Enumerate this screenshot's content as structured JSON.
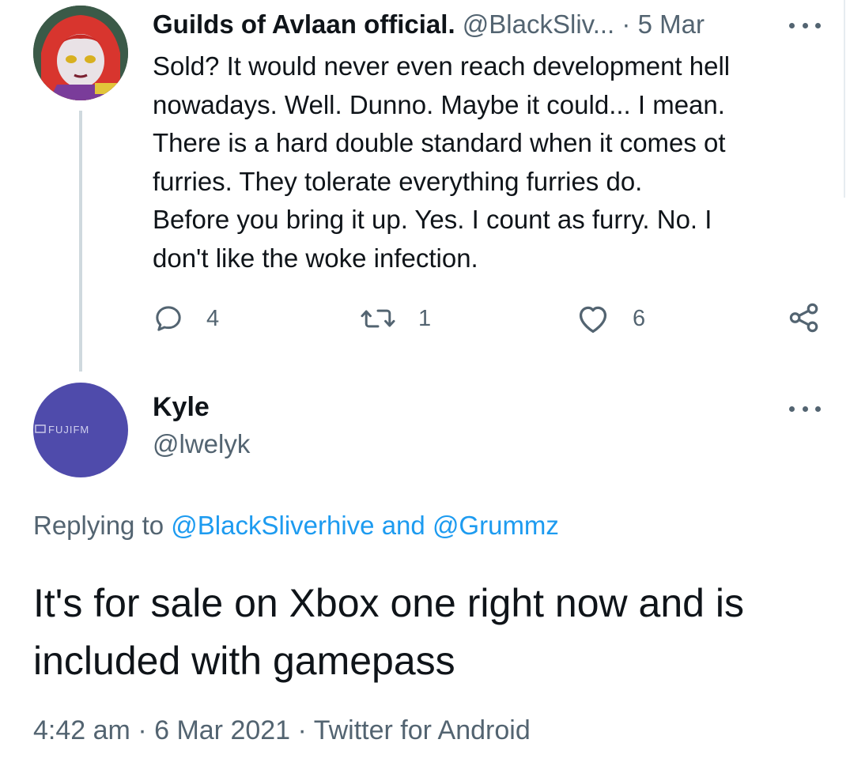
{
  "parent_tweet": {
    "display_name": "Guilds of Avlaan official.",
    "handle": "@BlackSliv...",
    "separator": "·",
    "date": "5 Mar",
    "lines": [
      "Sold? It would never even reach development hell",
      "nowadays. Well. Dunno. Maybe it could... I mean.",
      "There is a hard double standard when it comes ot",
      "furries. They tolerate everything furries do.",
      "Before you bring it up. Yes. I count as furry. No. I",
      "don't like the woke infection."
    ],
    "actions": {
      "reply_count": "4",
      "retweet_count": "1",
      "like_count": "6"
    }
  },
  "main_tweet": {
    "display_name": "Kyle",
    "handle": "@lwelyk",
    "avatar_text": "FUJIFM",
    "replying_prefix": "Replying to",
    "replying_to_1": "@BlackSliverhive",
    "replying_and": "and",
    "replying_to_2": "@Grummz",
    "text_lines": [
      "It's for sale on Xbox one right now and is",
      "included with gamepass"
    ],
    "time": "4:42 am",
    "separator": "·",
    "date": "6 Mar 2021",
    "client": "Twitter for Android"
  },
  "colors": {
    "link": "#1d9bf0",
    "secondary_text": "#536471",
    "primary_text": "#0f1419",
    "avatar2_bg": "#4f4bab"
  },
  "icons": [
    "reply-icon",
    "retweet-icon",
    "like-icon",
    "share-icon",
    "more-icon"
  ]
}
